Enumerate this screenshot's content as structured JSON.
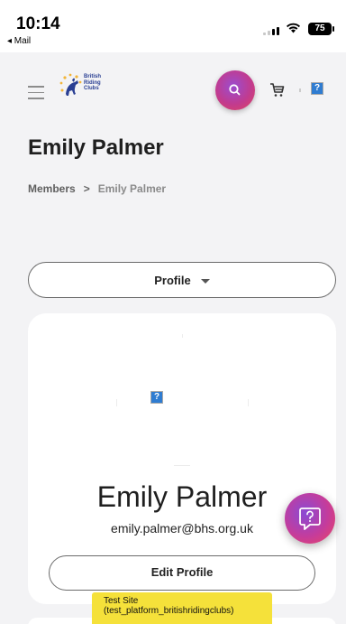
{
  "status_bar": {
    "time": "10:14",
    "back_app": "◂ Mail",
    "battery": "75"
  },
  "header": {
    "logo_text": [
      "British",
      "Riding",
      "Clubs"
    ],
    "avatar_placeholder": "?",
    "accent_gradient": [
      "#9a4dd0",
      "#e0455f"
    ]
  },
  "page": {
    "title": "Emily Palmer",
    "breadcrumb": {
      "parent": "Members",
      "separator": ">",
      "current": "Emily Palmer"
    }
  },
  "profile_dropdown": {
    "selected": "Profile"
  },
  "profile_card": {
    "avatar_placeholder": "?",
    "name": "Emily Palmer",
    "email": "emily.palmer@bhs.org.uk",
    "edit_label": "Edit Profile"
  },
  "test_banner": {
    "line1": "Test Site",
    "line2": "(test_platform_britishridingclubs)"
  }
}
